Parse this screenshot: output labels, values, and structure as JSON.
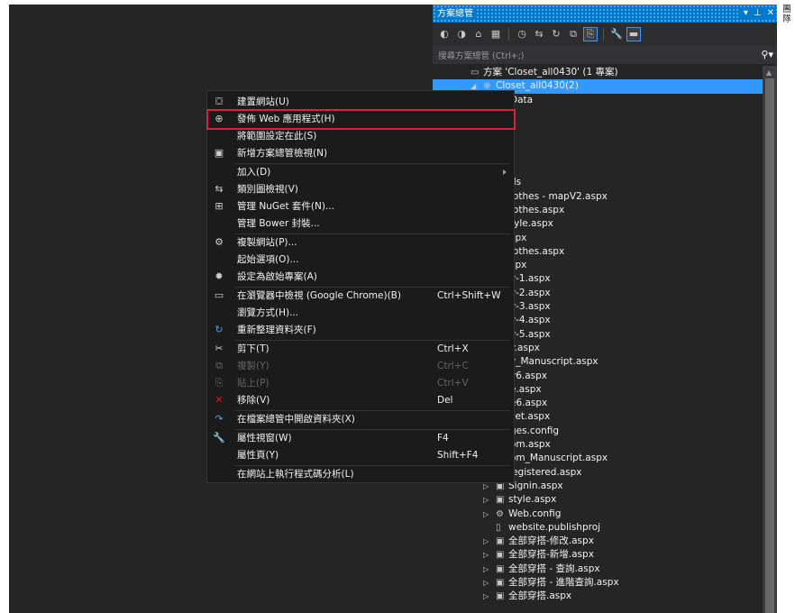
{
  "solution_explorer": {
    "title": "方案總管",
    "title_controls": [
      "▾",
      "⊥",
      "✕"
    ],
    "search_placeholder": "搜尋方案總管 (Ctrl+;)",
    "search_icon": "search-icon",
    "toolbar_icons": [
      "back-icon",
      "forward-icon",
      "home-icon",
      "switch-views-icon",
      "history-icon",
      "sync-icon",
      "refresh-icon",
      "collapse-all-icon",
      "show-all-files-icon",
      "properties-icon",
      "preview-icon"
    ],
    "tree": [
      {
        "label": "方案 'Closet_all0430' (1 專案)",
        "indent": 0,
        "arrow": "",
        "icon": "solution-icon"
      },
      {
        "label": "Closet_all0430(2)",
        "indent": 1,
        "arrow": "◢",
        "icon": "website-icon",
        "selected": true
      },
      {
        "label": "Data",
        "indent": 2,
        "arrow": "",
        "icon": ""
      },
      {
        "label": "",
        "indent": 2,
        "arrow": "",
        "icon": ""
      },
      {
        "label": "",
        "indent": 2,
        "arrow": "",
        "icon": ""
      },
      {
        "label": "",
        "indent": 2,
        "arrow": "",
        "icon": ""
      },
      {
        "label": "",
        "indent": 2,
        "arrow": "",
        "icon": ""
      },
      {
        "label": "",
        "indent": 2,
        "arrow": "",
        "icon": ""
      },
      {
        "label": "ds",
        "indent": 2,
        "arrow": "",
        "icon": ""
      },
      {
        "label": "lothes - mapV2.aspx",
        "indent": 2,
        "arrow": "",
        "icon": ""
      },
      {
        "label": "lothes.aspx",
        "indent": 2,
        "arrow": "",
        "icon": ""
      },
      {
        "label": "tyle.aspx",
        "indent": 2,
        "arrow": "",
        "icon": ""
      },
      {
        "label": "spx",
        "indent": 2,
        "arrow": "",
        "icon": ""
      },
      {
        "label": "lothes.aspx",
        "indent": 2,
        "arrow": "",
        "icon": ""
      },
      {
        "label": "spx",
        "indent": 2,
        "arrow": "",
        "icon": ""
      },
      {
        "label": "y-1.aspx",
        "indent": 2,
        "arrow": "",
        "icon": ""
      },
      {
        "label": "y-2.aspx",
        "indent": 2,
        "arrow": "",
        "icon": ""
      },
      {
        "label": "y-3.aspx",
        "indent": 2,
        "arrow": "",
        "icon": ""
      },
      {
        "label": "y-4.aspx",
        "indent": 2,
        "arrow": "",
        "icon": ""
      },
      {
        "label": "y-5.aspx",
        "indent": 2,
        "arrow": "",
        "icon": ""
      },
      {
        "label": "y.aspx",
        "indent": 2,
        "arrow": "",
        "icon": ""
      },
      {
        "label": "y_Manuscript.aspx",
        "indent": 2,
        "arrow": "",
        "icon": ""
      },
      {
        "label": "y6.aspx",
        "indent": 2,
        "arrow": "",
        "icon": ""
      },
      {
        "label": "e.aspx",
        "indent": 2,
        "arrow": "",
        "icon": ""
      },
      {
        "label": "e6.aspx",
        "indent": 2,
        "arrow": "",
        "icon": ""
      },
      {
        "label": "set.aspx",
        "indent": 2,
        "arrow": "",
        "icon": ""
      },
      {
        "label": "ges.config",
        "indent": 2,
        "arrow": "",
        "icon": ""
      },
      {
        "label": "om.aspx",
        "indent": 2,
        "arrow": "",
        "icon": ""
      },
      {
        "label": "om_Manuscript.aspx",
        "indent": 2,
        "arrow": "",
        "icon": ""
      },
      {
        "label": "registered.aspx",
        "indent": 2,
        "arrow": "▷",
        "icon": "aspx-file-icon"
      },
      {
        "label": "Signin.aspx",
        "indent": 2,
        "arrow": "▷",
        "icon": "aspx-file-icon"
      },
      {
        "label": "style.aspx",
        "indent": 2,
        "arrow": "▷",
        "icon": "aspx-file-icon"
      },
      {
        "label": "Web.config",
        "indent": 2,
        "arrow": "▷",
        "icon": "config-file-icon"
      },
      {
        "label": "website.publishproj",
        "indent": 2,
        "arrow": "",
        "icon": "publish-file-icon"
      },
      {
        "label": "全部穿搭-修改.aspx",
        "indent": 2,
        "arrow": "▷",
        "icon": "aspx-file-icon"
      },
      {
        "label": "全部穿搭-新增.aspx",
        "indent": 2,
        "arrow": "▷",
        "icon": "aspx-file-icon"
      },
      {
        "label": "全部穿搭 - 查詢.aspx",
        "indent": 2,
        "arrow": "▷",
        "icon": "aspx-file-icon"
      },
      {
        "label": "全部穿搭 - 進階查詢.aspx",
        "indent": 2,
        "arrow": "▷",
        "icon": "aspx-file-icon"
      },
      {
        "label": "全部穿搭.aspx",
        "indent": 2,
        "arrow": "▷",
        "icon": "aspx-file-icon"
      }
    ]
  },
  "context_menu": {
    "highlighted_item": "發佈 Web 應用程式(H)",
    "items": [
      {
        "label": "建置網站(U)",
        "shortcut": "",
        "icon": "build-icon",
        "glyph": "⛋",
        "submenu": false,
        "disabled": false
      },
      {
        "label": "發佈 Web 應用程式(H)",
        "shortcut": "",
        "icon": "publish-web-icon",
        "glyph": "⊕",
        "submenu": false,
        "disabled": false
      },
      {
        "label": "將範圍設定在此(S)",
        "shortcut": "",
        "icon": "",
        "glyph": "",
        "submenu": false,
        "disabled": false
      },
      {
        "label": "新增方案總管檢視(N)",
        "shortcut": "",
        "icon": "new-view-icon",
        "glyph": "▣",
        "submenu": false,
        "disabled": false
      },
      {
        "label": "加入(D)",
        "shortcut": "",
        "icon": "",
        "glyph": "",
        "submenu": true,
        "disabled": false,
        "sep_before": true
      },
      {
        "label": "類別圖檢視(V)",
        "shortcut": "",
        "icon": "class-diagram-icon",
        "glyph": "⇆",
        "submenu": false,
        "disabled": false
      },
      {
        "label": "管理 NuGet 套件(N)...",
        "shortcut": "",
        "icon": "nuget-icon",
        "glyph": "⊞",
        "submenu": false,
        "disabled": false
      },
      {
        "label": "管理 Bower 封裝...",
        "shortcut": "",
        "icon": "",
        "glyph": "",
        "submenu": false,
        "disabled": false
      },
      {
        "label": "複製網站(P)...",
        "shortcut": "",
        "icon": "copy-website-icon",
        "glyph": "⚙",
        "submenu": false,
        "disabled": false,
        "sep_before": true
      },
      {
        "label": "起始選項(O)...",
        "shortcut": "",
        "icon": "",
        "glyph": "",
        "submenu": false,
        "disabled": false
      },
      {
        "label": "設定為啟始專案(A)",
        "shortcut": "",
        "icon": "settings-icon",
        "glyph": "✹",
        "submenu": false,
        "disabled": false
      },
      {
        "label": "在瀏覽器中檢視 (Google Chrome)(B)",
        "shortcut": "Ctrl+Shift+W",
        "icon": "view-in-browser-icon",
        "glyph": "▭",
        "submenu": false,
        "disabled": false,
        "sep_before": true
      },
      {
        "label": "瀏覽方式(H)...",
        "shortcut": "",
        "icon": "",
        "glyph": "",
        "submenu": false,
        "disabled": false
      },
      {
        "label": "重新整理資料夾(F)",
        "shortcut": "",
        "icon": "refresh-icon",
        "glyph": "↻",
        "submenu": false,
        "disabled": false
      },
      {
        "label": "剪下(T)",
        "shortcut": "Ctrl+X",
        "icon": "cut-icon",
        "glyph": "✂",
        "submenu": false,
        "disabled": false,
        "sep_before": true
      },
      {
        "label": "複製(Y)",
        "shortcut": "Ctrl+C",
        "icon": "copy-icon",
        "glyph": "⧉",
        "submenu": false,
        "disabled": true
      },
      {
        "label": "貼上(P)",
        "shortcut": "Ctrl+V",
        "icon": "paste-icon",
        "glyph": "⎘",
        "submenu": false,
        "disabled": true
      },
      {
        "label": "移除(V)",
        "shortcut": "Del",
        "icon": "delete-icon",
        "glyph": "✕",
        "submenu": false,
        "disabled": false
      },
      {
        "label": "在檔案總管中開啟資料夾(X)",
        "shortcut": "",
        "icon": "open-folder-icon",
        "glyph": "↷",
        "submenu": false,
        "disabled": false,
        "sep_before": true
      },
      {
        "label": "屬性視窗(W)",
        "shortcut": "F4",
        "icon": "properties-wrench-icon",
        "glyph": "🔧",
        "submenu": false,
        "disabled": false,
        "sep_before": true
      },
      {
        "label": "屬性頁(Y)",
        "shortcut": "Shift+F4",
        "icon": "",
        "glyph": "",
        "submenu": false,
        "disabled": false
      },
      {
        "label": "在網站上執行程式碼分析(L)",
        "shortcut": "",
        "icon": "",
        "glyph": "",
        "submenu": false,
        "disabled": false,
        "sep_before": true
      }
    ]
  },
  "right_strip": {
    "text": "團隊"
  },
  "colors": {
    "accent": "#007acc",
    "selection": "#3399ff",
    "highlight_border": "#e0203a",
    "menu_bg": "#1b1b1c",
    "panel_bg": "#252526"
  }
}
